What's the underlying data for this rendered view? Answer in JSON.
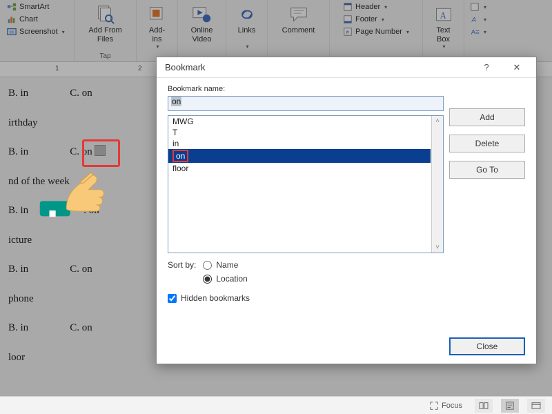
{
  "ribbon": {
    "left": {
      "smartart": "SmartArt",
      "chart": "Chart",
      "screenshot": "Screenshot"
    },
    "addfiles": "Add From\nFiles",
    "addins": "Add-\nins",
    "video": "Online\nVideo",
    "links": "Links",
    "comment": "Comment",
    "header": "Header",
    "footer": "Footer",
    "pagenum": "Page Number",
    "textbox": "Text\nBox",
    "tap_label": "Tap"
  },
  "ruler": {
    "t1": "1",
    "t2": "2"
  },
  "doc": {
    "b_in": "B. in",
    "c_on": "C. on",
    "birthday": "irthday",
    "weekend": "nd of the week",
    "picture": "icture",
    "phone": "phone",
    "floor": "loor",
    "partial_on": ". on"
  },
  "dialog": {
    "title": "Bookmark",
    "help": "?",
    "close_x": "✕",
    "name_label": "Bookmark name:",
    "name_value": "on",
    "items": [
      "MWG",
      "T",
      "in",
      "on",
      "floor"
    ],
    "selected_index": 3,
    "add": "Add",
    "delete": "Delete",
    "goto": "Go To",
    "sort_by": "Sort by:",
    "sort_name": "Name",
    "sort_location": "Location",
    "hidden": "Hidden bookmarks",
    "close": "Close"
  },
  "status": {
    "focus": "Focus"
  }
}
